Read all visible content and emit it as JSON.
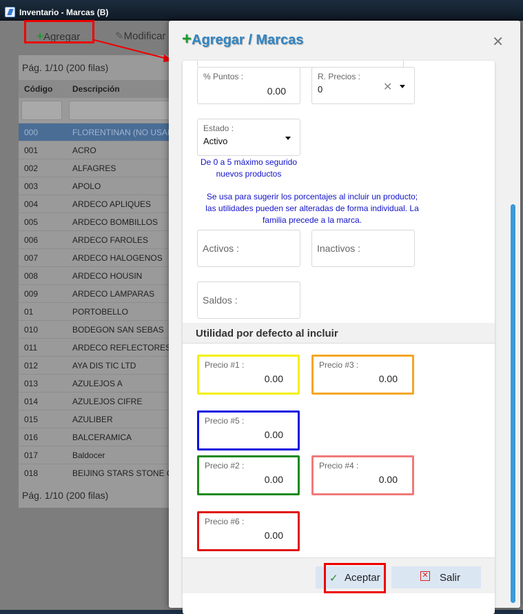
{
  "window": {
    "title": "Inventario - Marcas (B)"
  },
  "toolbar": {
    "add_label": "Agregar",
    "edit_label": "Modificar"
  },
  "grid": {
    "pagination_top": "Pág. 1/10 (200 filas)",
    "pagination_bottom": "Pág. 1/10 (200 filas)",
    "columns": [
      "Código",
      "Descripción"
    ],
    "rows": [
      {
        "code": "000",
        "desc": "FLORENTINAN (NO USAR)"
      },
      {
        "code": "001",
        "desc": "ACRO"
      },
      {
        "code": "002",
        "desc": "ALFAGRES"
      },
      {
        "code": "003",
        "desc": "APOLO"
      },
      {
        "code": "004",
        "desc": "ARDECO APLIQUES"
      },
      {
        "code": "005",
        "desc": "ARDECO BOMBILLOS"
      },
      {
        "code": "006",
        "desc": "ARDECO FAROLES"
      },
      {
        "code": "007",
        "desc": "ARDECO HALOGENOS"
      },
      {
        "code": "008",
        "desc": "ARDECO HOUSIN"
      },
      {
        "code": "009",
        "desc": "ARDECO LAMPARAS"
      },
      {
        "code": "01",
        "desc": "PORTOBELLO"
      },
      {
        "code": "010",
        "desc": "BODEGON SAN SEBAS"
      },
      {
        "code": "011",
        "desc": "ARDECO REFLECTORES"
      },
      {
        "code": "012",
        "desc": "AYA DIS TIC LTD"
      },
      {
        "code": "013",
        "desc": "AZULEJOS A"
      },
      {
        "code": "014",
        "desc": "AZULEJOS CIFRE"
      },
      {
        "code": "015",
        "desc": "AZULIBER"
      },
      {
        "code": "016",
        "desc": "BALCERAMICA"
      },
      {
        "code": "017",
        "desc": "Baldocer"
      },
      {
        "code": "018",
        "desc": "BEIJING STARS STONE CO"
      }
    ]
  },
  "modal": {
    "title": "Agregar / Marcas",
    "close_icon": "close-icon",
    "puntos": {
      "label": "% Puntos :",
      "value": "0.00"
    },
    "r_precios": {
      "label": "R. Precios :",
      "value": "0"
    },
    "estado": {
      "label": "Estado :",
      "value": "Activo"
    },
    "note_puntos": "De 0 a 5 máximo seguridonuevos productos",
    "note_puntos_l1": "De 0 a 5 máximo seguriddo",
    "note_r1": "De 0 a 5 máximo segurido",
    "note_r2": "nuevos productos",
    "note_utility": "Se usa para sugerir los porcentajes al incluir un producto; las utilidades pueden ser alteradas de forma individual. La familia precede a la marca.",
    "activos_label": "Activos :",
    "inactivos_label": "Inactivos :",
    "saldos_label": "Saldos :",
    "section_title": "Utilidad por defecto al incluir",
    "prices": [
      {
        "label": "Precio #1 :",
        "value": "0.00",
        "color": "#f5f000"
      },
      {
        "label": "Precio #3 :",
        "value": "0.00",
        "color": "#f5a623"
      },
      {
        "label": "Precio #5 :",
        "value": "0.00",
        "color": "#1010e0"
      },
      {
        "label": "Precio #2 :",
        "value": "0.00",
        "color": "#1a8a1a"
      },
      {
        "label": "Precio #4 :",
        "value": "0.00",
        "color": "#f07a7a"
      },
      {
        "label": "Precio #6 :",
        "value": "0.00",
        "color": "#e01010"
      }
    ],
    "accept_label": "Aceptar",
    "exit_label": "Salir"
  }
}
